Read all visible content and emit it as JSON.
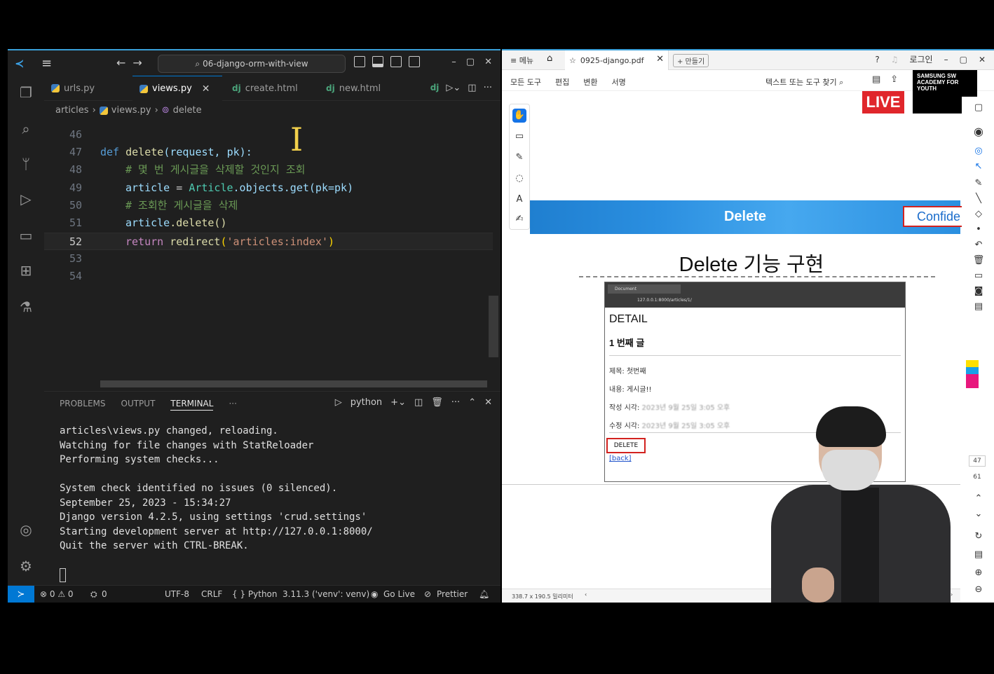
{
  "vscode": {
    "search": "06-django-orm-with-view",
    "tabs": [
      {
        "label": "urls.py",
        "icon": "python-icon"
      },
      {
        "label": "views.py",
        "icon": "python-icon"
      },
      {
        "label": "create.html",
        "icon": "django-icon"
      },
      {
        "label": "new.html",
        "icon": "django-icon"
      }
    ],
    "breadcrumb": {
      "folder": "articles",
      "file": "views.py",
      "symbol": "delete"
    },
    "code": {
      "l46": {
        "no": "46"
      },
      "l47": {
        "no": "47",
        "def": "def",
        "name": "delete",
        "params": "(request, pk):"
      },
      "l48": {
        "no": "48",
        "comment": "# 몇 번 게시글을 삭제할 것인지 조회"
      },
      "l49": {
        "no": "49",
        "var": "article",
        "eq": " = ",
        "cls": "Article",
        "rest": ".objects.get(pk=pk)"
      },
      "l50": {
        "no": "50",
        "comment": "# 조회한 게시글을 삭제"
      },
      "l51": {
        "no": "51",
        "var": "article",
        "rest": ".delete()"
      },
      "l52": {
        "no": "52",
        "ret": "return",
        "fn": " redirect",
        "open": "(",
        "str": "'articles:index'",
        "close": ")"
      },
      "l53": {
        "no": "53"
      },
      "l54": {
        "no": "54"
      }
    },
    "panel": {
      "tabs": [
        "PROBLEMS",
        "OUTPUT",
        "TERMINAL",
        "···"
      ],
      "shell": "python",
      "terminal": "articles\\views.py changed, reloading.\nWatching for file changes with StatReloader\nPerforming system checks...\n\nSystem check identified no issues (0 silenced).\nSeptember 25, 2023 - 15:34:27\nDjango version 4.2.5, using settings 'crud.settings'\nStarting development server at http://127.0.0.1:8000/\nQuit the server with CTRL-BREAK."
    },
    "status": {
      "problems": "⊗ 0 ⚠ 0",
      "ports": "0",
      "encoding": "UTF-8",
      "eol": "CRLF",
      "language": "{ } Python",
      "interpreter": "3.11.3 ('venv': venv)",
      "golive": "Go Live",
      "prettier": "Prettier"
    }
  },
  "pdf": {
    "menu": "메뉴",
    "tab_title": "0925-django.pdf",
    "new_tab": "+ 만들기",
    "login": "로그인",
    "toolbar": [
      "모든 도구",
      "편집",
      "변환",
      "서명"
    ],
    "find": "텍스트 또는 도구 찾기",
    "live": "LIVE",
    "brand": "SAMSUNG SW ACADEMY FOR YOUTH",
    "slide": {
      "banner": "Delete",
      "banner_right": "Confide",
      "title": "Delete 기능 구현",
      "shot": {
        "tab": "Document",
        "url": "127.0.0.1:8000/articles/1/",
        "heading": "DETAIL",
        "subheading": "1 번째 글",
        "fields": [
          {
            "label": "제목: 첫번째",
            "blur": ""
          },
          {
            "label": "내용: 게시글!!",
            "blur": ""
          },
          {
            "label": "작성 시각: ",
            "blur": "2023년 9월 25일 3:05 오후"
          },
          {
            "label": "수정 시각: ",
            "blur": "2023년 9월 25일 3:05 오후"
          }
        ],
        "delete_btn": "DELETE",
        "back": "[back]"
      }
    },
    "status": "338.7 x 190.5 밀리미터",
    "pages": {
      "current": "47",
      "total": "61"
    },
    "colors": {
      "accent": "#1473e6",
      "live": "#e0262b",
      "banner": "#2b8fe0"
    }
  }
}
